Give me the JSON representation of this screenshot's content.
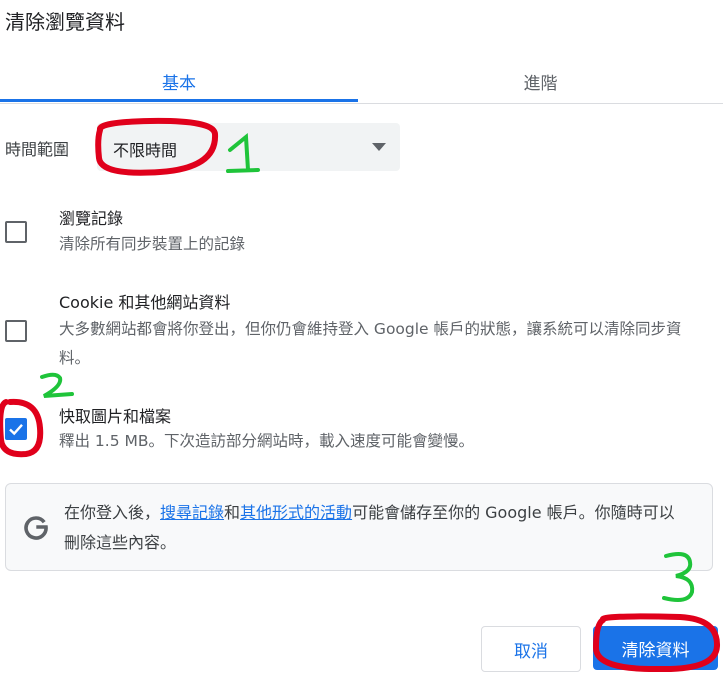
{
  "dialog": {
    "title": "清除瀏覽資料"
  },
  "tabs": [
    {
      "label": "基本",
      "selected": true
    },
    {
      "label": "進階",
      "selected": false
    }
  ],
  "time_range": {
    "label": "時間範圍",
    "value": "不限時間"
  },
  "items": [
    {
      "title": "瀏覽記錄",
      "desc": "清除所有同步裝置上的記錄",
      "checked": false
    },
    {
      "title": "Cookie 和其他網站資料",
      "desc": "大多數網站都會將你登出，但你仍會維持登入 Google 帳戶的狀態，讓系統可以清除同步資料。",
      "checked": false
    },
    {
      "title": "快取圖片和檔案",
      "desc": "釋出 1.5 MB。下次造訪部分網站時，載入速度可能會變慢。",
      "checked": true
    }
  ],
  "info": {
    "prefix": "在你登入後，",
    "link1": "搜尋記錄",
    "middle": "和",
    "link2": "其他形式的活動",
    "suffix": "可能會儲存至你的 Google 帳戶。你隨時可以刪除這些內容。"
  },
  "buttons": {
    "cancel": "取消",
    "clear": "清除資料"
  },
  "annotations": {
    "step1": "1",
    "step2": "2",
    "step3": "3"
  },
  "colors": {
    "accent": "#1a73e8",
    "annotation_red": "#e0001b",
    "annotation_green": "#1fc43a"
  },
  "icons": {
    "dropdown": "chevron-down-icon",
    "checkbox_check": "checkmark-icon",
    "google": "google-g-icon"
  }
}
